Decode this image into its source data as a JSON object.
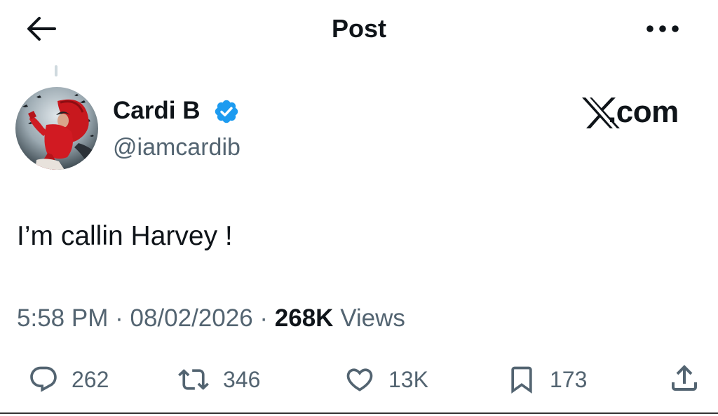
{
  "header": {
    "title": "Post",
    "back_icon": "arrow-left-icon",
    "more_icon": "more-horizontal-icon"
  },
  "author": {
    "name": "Cardi B",
    "handle": "@iamcardib",
    "verified": true,
    "verified_color": "#1d9bf0"
  },
  "brand": {
    "label": "X.com",
    "logo_letter": "X",
    "text_after_logo": ".com"
  },
  "post": {
    "text": "I’m callin Harvey !"
  },
  "meta": {
    "time": "5:58 PM",
    "separator": "·",
    "date": "08/02/2026",
    "views_count": "268K",
    "views_label": "Views"
  },
  "actions": {
    "reply": {
      "icon": "reply-bubble-icon",
      "count": "262"
    },
    "retweet": {
      "icon": "retweet-icon",
      "count": "346"
    },
    "like": {
      "icon": "heart-icon",
      "count": "13K"
    },
    "bookmark": {
      "icon": "bookmark-icon",
      "count": "173"
    },
    "share": {
      "icon": "share-upload-icon"
    }
  },
  "colors": {
    "text_primary": "#0f1419",
    "text_secondary": "#536471",
    "accent": "#1d9bf0",
    "background": "#ffffff"
  }
}
